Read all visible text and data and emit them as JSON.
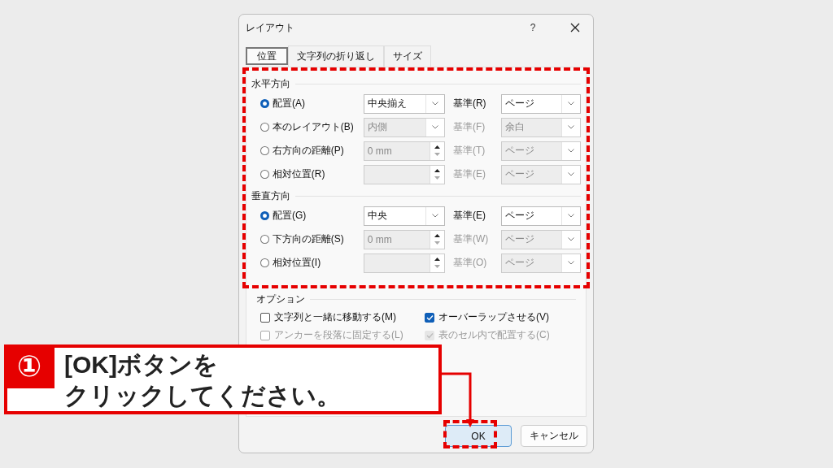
{
  "window": {
    "title": "レイアウト",
    "help": "?"
  },
  "tabs": [
    {
      "label": "位置",
      "selected": true
    },
    {
      "label": "文字列の折り返し",
      "selected": false
    },
    {
      "label": "サイズ",
      "selected": false
    }
  ],
  "sections": [
    {
      "title": "水平方向",
      "rows": [
        {
          "label": "配置(A)",
          "selected": true,
          "disabled": false,
          "field": {
            "kind": "combo",
            "value": "中央揃え"
          },
          "ref_label": "基準(R)",
          "ref_value": "ページ"
        },
        {
          "label": "本のレイアウト(B)",
          "selected": false,
          "disabled": true,
          "field": {
            "kind": "combo",
            "value": "内側"
          },
          "ref_label": "基準(F)",
          "ref_value": "余白"
        },
        {
          "label": "右方向の距離(P)",
          "selected": false,
          "disabled": true,
          "field": {
            "kind": "spin",
            "value": "0 mm"
          },
          "ref_label": "基準(T)",
          "ref_value": "ページ"
        },
        {
          "label": "相対位置(R)",
          "selected": false,
          "disabled": true,
          "field": {
            "kind": "spin"
          },
          "ref_label": "基準(E)",
          "ref_value": "ページ"
        }
      ]
    },
    {
      "title": "垂直方向",
      "rows": [
        {
          "label": "配置(G)",
          "selected": true,
          "disabled": false,
          "field": {
            "kind": "combo",
            "value": "中央"
          },
          "ref_label": "基準(E)",
          "ref_value": "ページ"
        },
        {
          "label": "下方向の距離(S)",
          "selected": false,
          "disabled": true,
          "field": {
            "kind": "spin",
            "value": "0 mm"
          },
          "ref_label": "基準(W)",
          "ref_value": "ページ"
        },
        {
          "label": "相対位置(I)",
          "selected": false,
          "disabled": true,
          "field": {
            "kind": "spin"
          },
          "ref_label": "基準(O)",
          "ref_value": "ページ"
        }
      ]
    }
  ],
  "options": {
    "title": "オプション",
    "items": [
      {
        "label": "文字列と一緒に移動する(M)",
        "checked": false,
        "disabled": false
      },
      {
        "label": "オーバーラップさせる(V)",
        "checked": true,
        "disabled": false
      },
      {
        "label": "アンカーを段落に固定する(L)",
        "checked": false,
        "disabled": true
      },
      {
        "label": "表のセル内で配置する(C)",
        "checked": true,
        "disabled": true
      }
    ]
  },
  "buttons": [
    {
      "label": "OK",
      "default": true
    },
    {
      "label": "キャンセル",
      "default": false
    }
  ],
  "callout": {
    "number": "①",
    "lines": [
      "[OK]ボタンを",
      "クリックしてください。"
    ]
  }
}
